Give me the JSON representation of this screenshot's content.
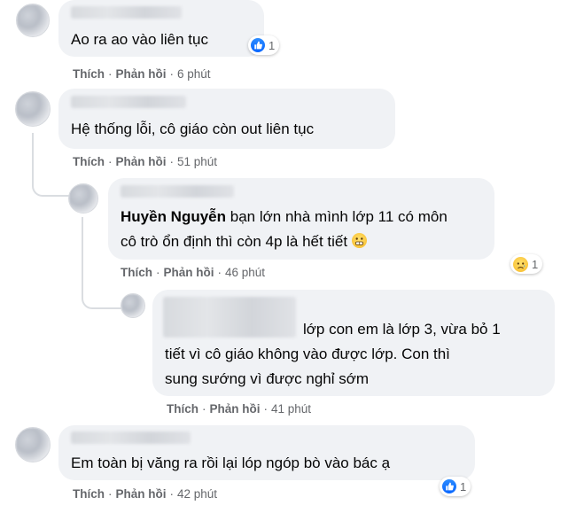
{
  "comments": [
    {
      "text": "Ao ra ao vào liên tục",
      "actions": {
        "like": "Thích",
        "reply": "Phản hồi",
        "time": "6 phút"
      },
      "reaction": {
        "type": "like",
        "count": "1"
      }
    },
    {
      "text": "Hệ thống lỗi, cô giáo còn out liên tục",
      "actions": {
        "like": "Thích",
        "reply": "Phản hồi",
        "time": "51 phút"
      }
    },
    {
      "mention": "Huyền Nguyễn",
      "text_line1": " bạn lớn nhà mình lớp 11 có môn",
      "text_line2": "cô trò ổn định thì còn 4p là hết tiết",
      "actions": {
        "like": "Thích",
        "reply": "Phản hồi",
        "time": "46 phút"
      },
      "reaction": {
        "type": "sad",
        "count": "1"
      }
    },
    {
      "text_line1": "lớp con em là lớp 3, vừa bỏ 1",
      "text_line2": "tiết vì cô giáo không vào được lớp. Con thì",
      "text_line3": "sung sướng vì được nghỉ sớm",
      "actions": {
        "like": "Thích",
        "reply": "Phản hồi",
        "time": "41 phút"
      }
    },
    {
      "text": "Em toàn bị văng ra rồi lại lóp ngóp bò vào bác ạ",
      "actions": {
        "like": "Thích",
        "reply": "Phản hồi",
        "time": "42 phút"
      },
      "reaction": {
        "type": "like",
        "count": "1"
      }
    }
  ],
  "colors": {
    "bubble": "#f0f2f5",
    "meta_text": "#65676b",
    "like_blue": "#0866ff",
    "sad_yellow": "#f7b928"
  }
}
